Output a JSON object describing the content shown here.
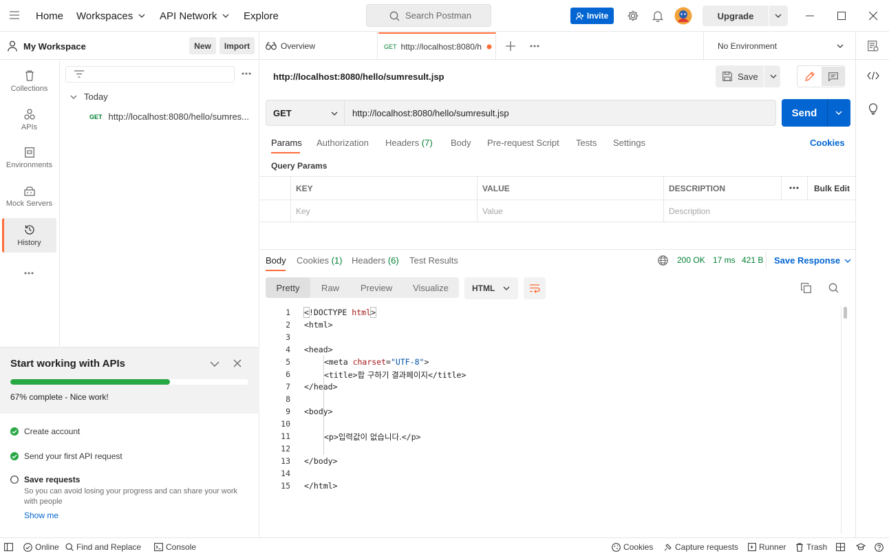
{
  "topbar": {
    "nav": [
      "Home",
      "Workspaces",
      "API Network",
      "Explore"
    ],
    "search_placeholder": "Search Postman",
    "invite_label": "Invite",
    "upgrade_label": "Upgrade"
  },
  "sidebar": {
    "workspace_name": "My Workspace",
    "new_label": "New",
    "import_label": "Import",
    "rail": [
      {
        "label": "Collections",
        "icon": "trash-can-icon"
      },
      {
        "label": "APIs",
        "icon": "apis-icon"
      },
      {
        "label": "Environments",
        "icon": "environment-icon"
      },
      {
        "label": "Mock Servers",
        "icon": "mock-server-icon"
      },
      {
        "label": "History",
        "icon": "history-icon"
      }
    ],
    "history": {
      "group": "Today",
      "items": [
        {
          "method": "GET",
          "url": "http://localhost:8080/hello/sumres..."
        }
      ]
    }
  },
  "onboarding": {
    "title": "Start working with APIs",
    "progress_percent": 67,
    "progress_text": "67% complete - Nice work!",
    "tasks": [
      {
        "label": "Create account",
        "done": true
      },
      {
        "label": "Send your first API request",
        "done": true
      },
      {
        "label": "Save requests",
        "done": false,
        "description": "So you can avoid losing your progress and can share your work with people"
      }
    ],
    "show_me": "Show me"
  },
  "tabs": {
    "overview": "Overview",
    "active_method": "GET",
    "active_url": "http://localhost:8080/h",
    "environment": "No Environment"
  },
  "request": {
    "title": "http://localhost:8080/hello/sumresult.jsp",
    "save_label": "Save",
    "method": "GET",
    "url": "http://localhost:8080/hello/sumresult.jsp",
    "send_label": "Send",
    "subtabs": [
      "Params",
      "Authorization",
      "Headers",
      "(7)",
      "Body",
      "Pre-request Script",
      "Tests",
      "Settings"
    ],
    "cookies_link": "Cookies",
    "query_params_label": "Query Params",
    "table": {
      "headers": [
        "KEY",
        "VALUE",
        "DESCRIPTION"
      ],
      "bulk_edit": "Bulk Edit",
      "placeholders": [
        "Key",
        "Value",
        "Description"
      ]
    }
  },
  "response": {
    "tabs": [
      "Body",
      "Cookies",
      "(1)",
      "Headers",
      "(6)",
      "Test Results"
    ],
    "status": "200 OK",
    "time": "17 ms",
    "size": "421 B",
    "save_response": "Save Response",
    "views": [
      "Pretty",
      "Raw",
      "Preview",
      "Visualize"
    ],
    "format": "HTML",
    "line_numbers": [
      "1",
      "2",
      "3",
      "4",
      "5",
      "6",
      "7",
      "8",
      "9",
      "10",
      "11",
      "12",
      "13",
      "14",
      "15"
    ],
    "code": {
      "l1_open": "<",
      "l1_doctype": "!DOCTYPE",
      "l1_html": "html",
      "l1_close": ">",
      "l2": "<html>",
      "l4": "<head>",
      "l5_meta": "<meta",
      "l5_attr": "charset",
      "l5_eq": "=",
      "l5_val": "\"UTF-8\"",
      "l5_close": ">",
      "l6_open": "<title>",
      "l6_text": "합 구하기 결과페이지",
      "l6_close": "</title>",
      "l7": "</head>",
      "l9": "<body>",
      "l11_open": "<p>",
      "l11_text": "입력값이 없습니다.",
      "l11_close": "</p>",
      "l13": "</body>",
      "l15": "</html>"
    }
  },
  "statusbar": {
    "online": "Online",
    "find_replace": "Find and Replace",
    "console": "Console",
    "cookies": "Cookies",
    "capture": "Capture requests",
    "runner": "Runner",
    "trash": "Trash"
  },
  "colors": {
    "accent": "#ff6c37",
    "primary": "#0265d2",
    "success": "#007f31",
    "progress": "#28a745"
  }
}
